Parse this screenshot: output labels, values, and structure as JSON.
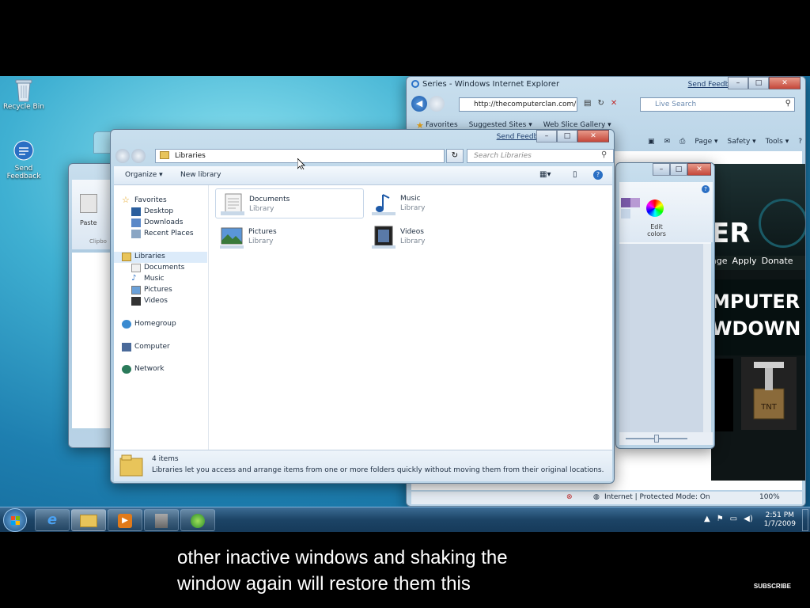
{
  "desktop": {
    "icons": [
      {
        "label": "Recycle Bin"
      },
      {
        "label": "Send Feedback"
      }
    ]
  },
  "ie": {
    "title": "Series - Windows Internet Explorer",
    "send_feedback": "Send Feedback",
    "address": "http://thecomputerclan.com/",
    "search_placeholder": "Live Search",
    "favorites": "Favorites",
    "suggested_sites": "Suggested Sites ▾",
    "web_slice": "Web Slice Gallery ▾",
    "cmd_page": "Page ▾",
    "cmd_safety": "Safety ▾",
    "cmd_tools": "Tools ▾",
    "site_nav": [
      "age",
      "Apply",
      "Donate"
    ],
    "site_big1": "ER",
    "site_big2": "MPUTER",
    "site_big3": "WDOWN",
    "status_text": "Internet | Protected Mode: On",
    "zoom": "100%"
  },
  "paint": {
    "edit_colors": "Edit colors"
  },
  "leftwin": {
    "paste": "Paste",
    "clipboard": "Clipbo"
  },
  "explorer": {
    "send_feedback": "Send Feedback",
    "breadcrumb": "Libraries",
    "search_placeholder": "Search Libraries",
    "toolbar": {
      "organize": "Organize ▾",
      "new_library": "New library"
    },
    "nav": {
      "favorites": "Favorites",
      "desktop": "Desktop",
      "downloads": "Downloads",
      "recent_places": "Recent Places",
      "libraries": "Libraries",
      "documents": "Documents",
      "music": "Music",
      "pictures": "Pictures",
      "videos": "Videos",
      "homegroup": "Homegroup",
      "computer": "Computer",
      "network": "Network"
    },
    "libraries": [
      {
        "name": "Documents",
        "sub": "Library"
      },
      {
        "name": "Music",
        "sub": "Library"
      },
      {
        "name": "Pictures",
        "sub": "Library"
      },
      {
        "name": "Videos",
        "sub": "Library"
      }
    ],
    "details": {
      "count": "4 items",
      "description": "Libraries let you access and arrange items from one or more folders quickly without moving them from their original locations."
    }
  },
  "taskbar": {
    "time": "2:51 PM",
    "date": "1/7/2009"
  },
  "caption": {
    "line1": "other inactive windows and shaking the",
    "line2": "window again will restore them this"
  },
  "subscribe": "SUBSCRIBE",
  "colors": {
    "accent": "#1e7fb0",
    "taskbar": "#1c4466"
  }
}
